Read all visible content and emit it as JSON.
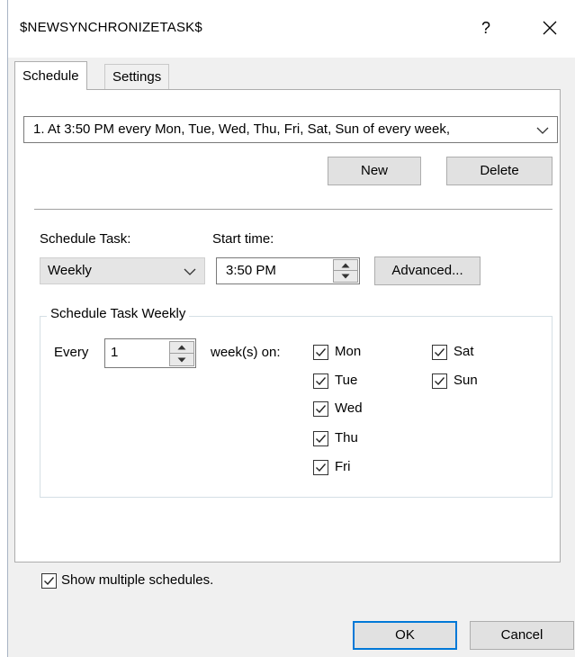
{
  "window": {
    "title": "$NEWSYNCHRONIZETASK$",
    "help_icon": "question-mark-icon",
    "close_icon": "close-icon"
  },
  "tabs": [
    {
      "label": "Schedule",
      "active": true
    },
    {
      "label": "Settings",
      "active": false
    }
  ],
  "schedule_list": {
    "selected": "1. At 3:50 PM every Mon, Tue, Wed, Thu, Fri, Sat, Sun of every week,"
  },
  "buttons": {
    "new": "New",
    "delete": "Delete",
    "advanced": "Advanced...",
    "ok": "OK",
    "cancel": "Cancel"
  },
  "schedule_task": {
    "label": "Schedule Task:",
    "value": "Weekly"
  },
  "start_time": {
    "label": "Start time:",
    "value": "3:50 PM"
  },
  "weekly_group": {
    "title": "Schedule Task Weekly",
    "every_label": "Every",
    "every_value": "1",
    "weeks_on_label": "week(s) on:",
    "days": [
      {
        "label": "Mon",
        "checked": true
      },
      {
        "label": "Tue",
        "checked": true
      },
      {
        "label": "Wed",
        "checked": true
      },
      {
        "label": "Thu",
        "checked": true
      },
      {
        "label": "Fri",
        "checked": true
      },
      {
        "label": "Sat",
        "checked": true
      },
      {
        "label": "Sun",
        "checked": true
      }
    ]
  },
  "show_multiple": {
    "label": "Show multiple schedules.",
    "checked": true
  },
  "colors": {
    "accent": "#0078d7",
    "dialog_bg": "#f0f0f0",
    "button_bg": "#e1e1e1"
  }
}
